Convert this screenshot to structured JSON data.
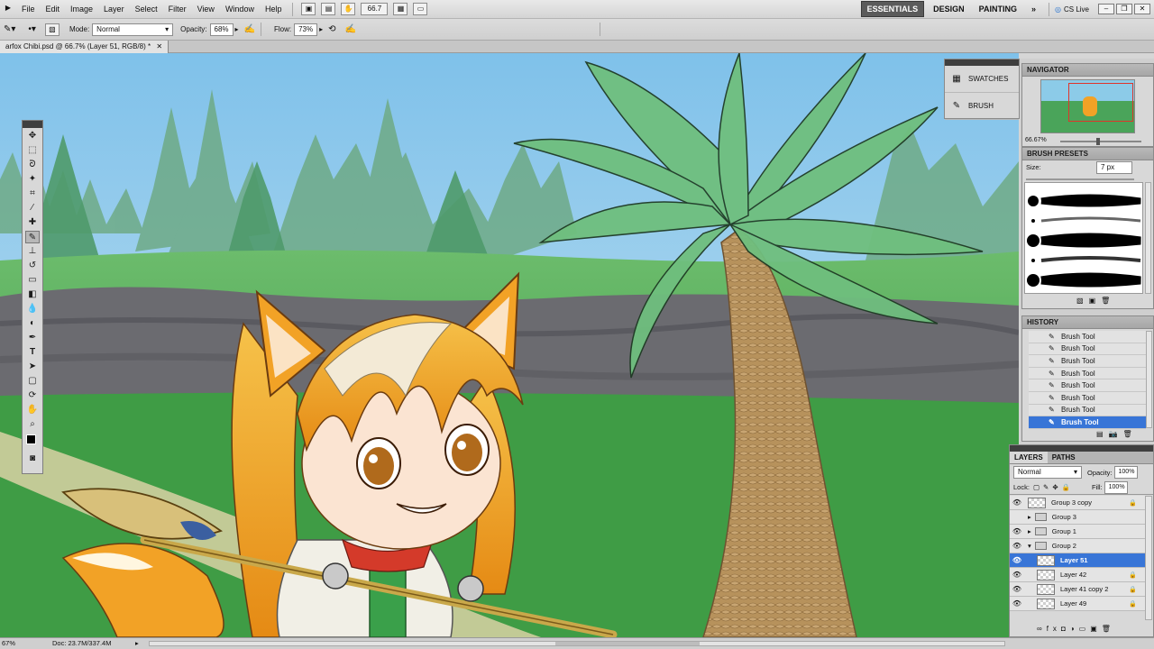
{
  "menubar": {
    "items": [
      "File",
      "Edit",
      "Image",
      "Layer",
      "Select",
      "Filter",
      "View",
      "Window",
      "Help"
    ],
    "zoom_value": "66.7",
    "workspaces": [
      "ESSENTIALS",
      "DESIGN",
      "PAINTING"
    ],
    "more_workspaces": "»",
    "cs_live": "CS Live"
  },
  "options": {
    "mode_label": "Mode:",
    "mode_value": "Normal",
    "opacity_label": "Opacity:",
    "opacity_value": "68%",
    "flow_label": "Flow:",
    "flow_value": "73%"
  },
  "document": {
    "tab_title": "arfox Chibi.psd @ 66.7% (Layer 51, RGB/8) *"
  },
  "icon_panels": {
    "swatches": "SWATCHES",
    "brush": "BRUSH"
  },
  "navigator": {
    "title": "NAVIGATOR",
    "zoom": "66.67%"
  },
  "brush_presets": {
    "title": "BRUSH PRESETS",
    "size_label": "Size:",
    "size_value": "7 px"
  },
  "history": {
    "title": "HISTORY",
    "items": [
      "Brush Tool",
      "Brush Tool",
      "Brush Tool",
      "Brush Tool",
      "Brush Tool",
      "Brush Tool",
      "Brush Tool",
      "Brush Tool"
    ]
  },
  "layers": {
    "tabs": [
      "LAYERS",
      "PATHS"
    ],
    "blend_mode": "Normal",
    "opacity_label": "Opacity:",
    "opacity_value": "100%",
    "lock_label": "Lock:",
    "fill_label": "Fill:",
    "fill_value": "100%",
    "items": [
      "Group 3 copy",
      "Group 3",
      "Group 1",
      "Group 2",
      "Layer 51",
      "Layer 42",
      "Layer 41 copy 2",
      "Layer 49"
    ]
  },
  "status": {
    "zoom": "67%",
    "doc_info": "Doc: 23.7M/337.4M"
  },
  "colors": {
    "accent": "#3875d7",
    "sky": "#9fcde9",
    "grass": "#3f9c45",
    "palm_leaf": "#6fbf7e",
    "trunk": "#b08a57",
    "hair": "#f2a226"
  }
}
